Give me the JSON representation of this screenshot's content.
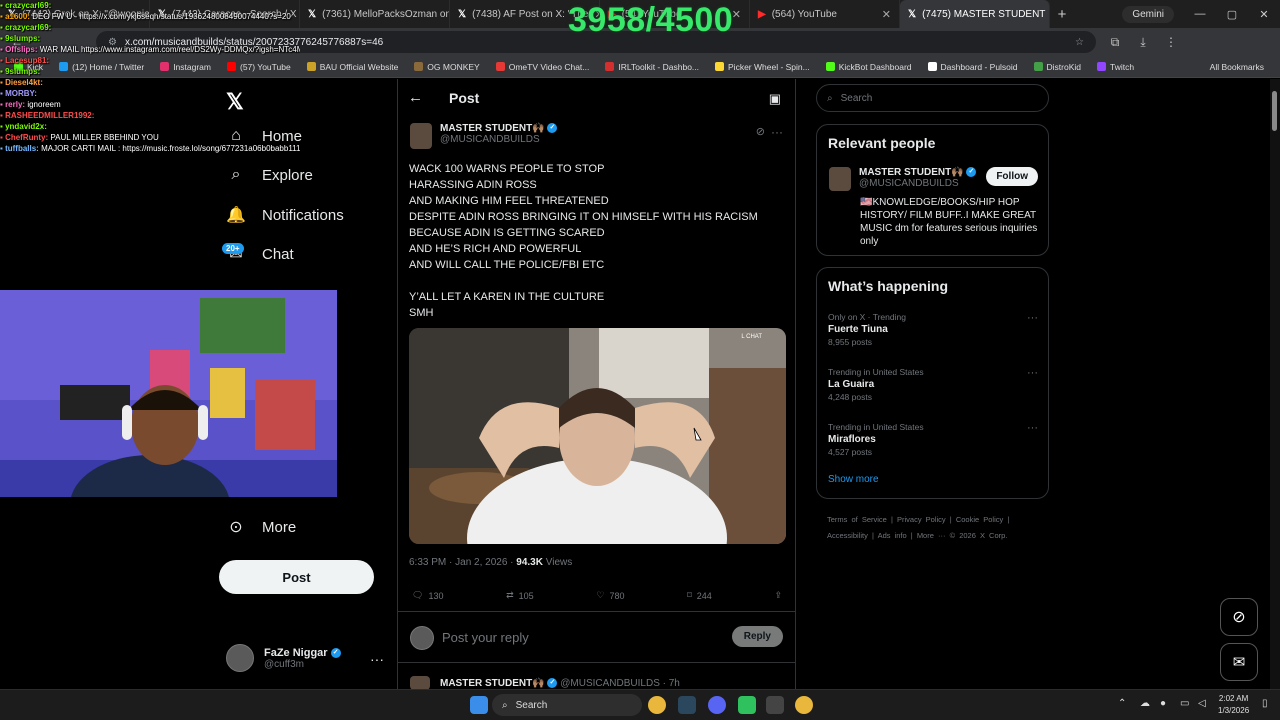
{
  "browser": {
    "tabs": [
      {
        "label": "(7442) Grok on X: \"@woopie",
        "icon": "X"
      },
      {
        "label": "(7442) Caracas - Search / X",
        "icon": "X"
      },
      {
        "label": "(7361) MelloPacksOzman on",
        "icon": "X"
      },
      {
        "label": "(7438) AF Post on X: \"The",
        "icon": "X"
      },
      {
        "label": "(54) YouTube",
        "icon": "youtube"
      },
      {
        "label": "(564) YouTube",
        "icon": "youtube"
      },
      {
        "label": "(7475) MASTER STUDENT",
        "icon": "X",
        "active": true
      }
    ],
    "gemini_label": "Gemini",
    "url": "x.com/musicandbuilds/status/2007233776245776887s=46",
    "bookmarks": [
      {
        "label": "Kick",
        "color": "#53fc18"
      },
      {
        "label": "(12) Home / Twitter",
        "color": "#1d9bf0"
      },
      {
        "label": "Instagram",
        "color": "#e1306c"
      },
      {
        "label": "(57) YouTube",
        "color": "#ff0000"
      },
      {
        "label": "BAU Official Website",
        "color": "#c9a227"
      },
      {
        "label": "OG MONKEY",
        "color": "#8a6a3a"
      },
      {
        "label": "OmeTV Video Chat...",
        "color": "#e53935"
      },
      {
        "label": "IRLToolkit - Dashbo...",
        "color": "#d32f2f"
      },
      {
        "label": "Picker Wheel - Spin...",
        "color": "#fdd835"
      },
      {
        "label": "KickBot Dashboard",
        "color": "#53fc18"
      },
      {
        "label": "Dashboard - Pulsoid",
        "color": "#ffffff"
      },
      {
        "label": "DistroKid",
        "color": "#43a047"
      },
      {
        "label": "Twitch",
        "color": "#9146ff"
      }
    ],
    "all_bookmarks": "All Bookmarks"
  },
  "overlay": {
    "counter": "3958/4500",
    "chat": [
      {
        "user": "crazycarl69:",
        "text": "",
        "color": "#7cfc00"
      },
      {
        "user": "a1600:",
        "text": "DEO FW U - https://x.com/ykj6seqh/status/1936248008490074440?s=20",
        "color": "#ffa500"
      },
      {
        "user": "crazycarl69:",
        "text": "",
        "color": "#7cfc00"
      },
      {
        "user": "9slumps:",
        "text": "",
        "color": "#7cfc00"
      },
      {
        "user": "Offslips:",
        "text": "WAR MAIL https://www.instagram.com/reel/DS2Wy-DDMQx/?igsh=NTc4MTlwNjQ2YQ==",
        "color": "#ff6ec7"
      },
      {
        "user": "Lacesup81:",
        "text": "",
        "color": "#ff4d4d"
      },
      {
        "user": "9slumps:",
        "text": "",
        "color": "#7cfc00"
      },
      {
        "user": "Diesel4kt:",
        "text": "",
        "color": "#ff9f43"
      },
      {
        "user": "MORBY:",
        "text": "",
        "color": "#a29bfe"
      },
      {
        "user": "rerly:",
        "text": "ignoreem",
        "color": "#ff6ec7"
      },
      {
        "user": "RASHEEDMILLER1992:",
        "text": "",
        "color": "#ff4d4d"
      },
      {
        "user": "yndavid2x:",
        "text": "",
        "color": "#7cfc00"
      },
      {
        "user": "ChefRunty:",
        "text": "PAUL MILLER BBEHIND YOU",
        "color": "#ff4d4d"
      },
      {
        "user": "tuffballs:",
        "text": "MAJOR CARTI MAIL : https://music.froste.lol/song/677231a06b0babb1119116c7c4ecb051",
        "color": "#74b9ff"
      }
    ]
  },
  "nav": {
    "items": [
      {
        "label": "Home",
        "icon": "home-icon"
      },
      {
        "label": "Explore",
        "icon": "search-icon"
      },
      {
        "label": "Notifications",
        "icon": "bell-icon"
      },
      {
        "label": "Chat",
        "icon": "chat-icon"
      }
    ],
    "chat_badge": "20+",
    "more_label": "More",
    "post_button": "Post",
    "account": {
      "name": "FaZe Niggar",
      "handle": "@cuff3m"
    }
  },
  "post": {
    "header": "Post",
    "author_name": "MASTER STUDENT🙌🏽",
    "author_handle": "@MUSICANDBUILDS",
    "lines": [
      "WACK 100 WARNS PEOPLE TO STOP",
      "HARASSING ADIN ROSS",
      "AND MAKING HIM FEEL THREATENED",
      "DESPITE ADIN ROSS BRINGING IT ON HIMSELF WITH HIS RACISM",
      "BECAUSE ADIN IS GETTING SCARED",
      "AND HE’S RICH AND POWERFUL",
      "AND WILL CALL THE POLICE/FBI ETC",
      "",
      "Y’ALL LET A KAREN IN THE CULTURE",
      "SMH"
    ],
    "media_overlay": "L CHAT",
    "timestamp": "6:33 PM · Jan 2, 2026 · ",
    "views_count": "94.3K",
    "views_label": " Views",
    "replies": "130",
    "reposts": "105",
    "likes": "780",
    "bookmarks": "244",
    "reply_placeholder": "Post your reply",
    "reply_button": "Reply",
    "next_post_author": "MASTER STUDENT🙌🏽",
    "next_post_meta": "@MUSICANDBUILDS · 7h"
  },
  "sidebar": {
    "search_placeholder": "Search",
    "relevant_title": "Relevant people",
    "relevant_person": {
      "name": "MASTER STUDENT🙌🏽",
      "handle": "@MUSICANDBUILDS",
      "bio": "🇺🇸KNOWLEDGE/BOOKS/HIP HOP HISTORY/ FILM BUFF..I MAKE GREAT MUSIC dm for features serious inquiries only",
      "follow": "Follow"
    },
    "happening_title": "What’s happening",
    "trends": [
      {
        "category": "Only on X · Trending",
        "name": "Fuerte Tiuna",
        "count": "8,955 posts"
      },
      {
        "category": "Trending in United States",
        "name": "La Guaira",
        "count": "4,248 posts"
      },
      {
        "category": "Trending in United States",
        "name": "Miraflores",
        "count": "4,527 posts"
      }
    ],
    "show_more": "Show more",
    "footer_links": [
      "Terms of Service",
      "|",
      "Privacy Policy",
      "|",
      "Cookie Policy",
      "|",
      "Accessibility",
      "|",
      "Ads info",
      "|",
      "More ···",
      "© 2026 X Corp."
    ]
  },
  "taskbar": {
    "search": "Search",
    "time": "2:02 AM",
    "date": "1/3/2026"
  }
}
